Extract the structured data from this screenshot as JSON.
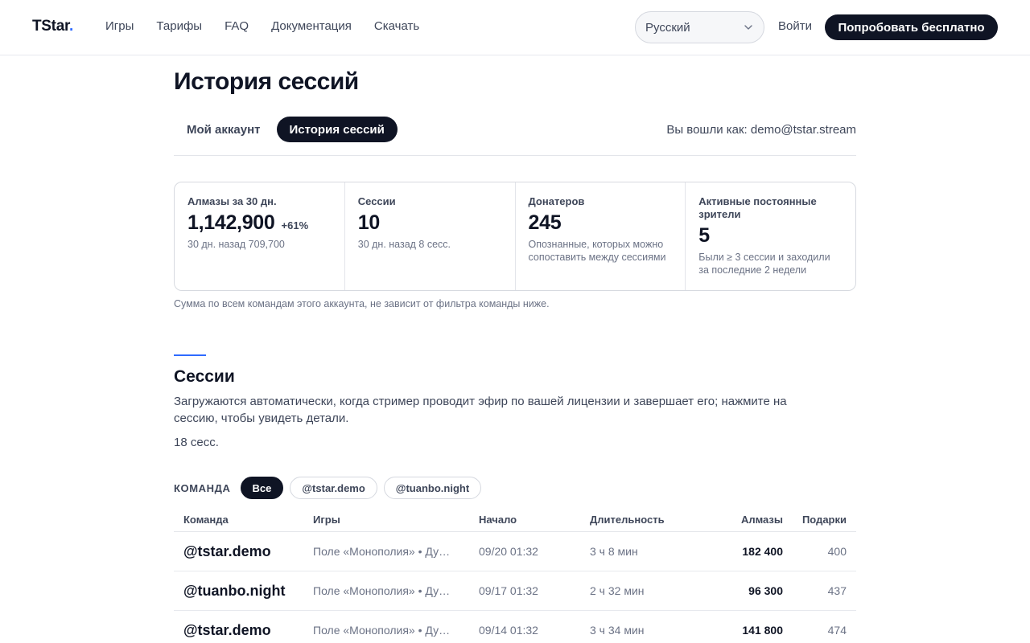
{
  "header": {
    "logo": "TStar",
    "logo_dot": ".",
    "nav": [
      "Игры",
      "Тарифы",
      "FAQ",
      "Документация",
      "Скачать"
    ],
    "language": "Русский",
    "login": "Войти",
    "cta": "Попробовать бесплатно"
  },
  "page": {
    "title": "История сессий",
    "tabs": [
      {
        "label": "Мой аккаунт",
        "active": false
      },
      {
        "label": "История сессий",
        "active": true
      }
    ],
    "logged_in_as": "Вы вошли как: demo@tstar.stream"
  },
  "stats": [
    {
      "label": "Алмазы за 30 дн.",
      "value": "1,142,900",
      "delta": "+61%",
      "sub": "30 дн. назад 709,700"
    },
    {
      "label": "Сессии",
      "value": "10",
      "delta": "",
      "sub": "30 дн. назад 8 сесс."
    },
    {
      "label": "Донатеров",
      "value": "245",
      "delta": "",
      "sub": "Опознанные, которых можно сопоставить между сессиями"
    },
    {
      "label": "Активные постоянные зрители",
      "value": "5",
      "delta": "",
      "sub": "Были ≥ 3 сессии и заходили за последние 2 недели"
    }
  ],
  "stats_note": "Сумма по всем командам этого аккаунта, не зависит от фильтра команды ниже.",
  "sessions": {
    "title": "Сессии",
    "description": "Загружаются автоматически, когда стример проводит эфир по вашей лицензии и завершает его; нажмите на сессию, чтобы увидеть детали.",
    "count": "18 сесс.",
    "filter_label": "КОМАНДА",
    "filters": [
      {
        "label": "Все",
        "active": true
      },
      {
        "label": "@tstar.demo",
        "active": false
      },
      {
        "label": "@tuanbo.night",
        "active": false
      }
    ],
    "columns": {
      "team": "Команда",
      "games": "Игры",
      "start": "Начало",
      "duration": "Длительность",
      "diamonds": "Алмазы",
      "gifts": "Подарки"
    },
    "rows": [
      {
        "team": "@tstar.demo",
        "games": "Поле «Монополия» • Ду…",
        "start": "09/20 01:32",
        "duration": "3 ч 8 мин",
        "diamonds": "182 400",
        "gifts": "400"
      },
      {
        "team": "@tuanbo.night",
        "games": "Поле «Монополия» • Ду…",
        "start": "09/17 01:32",
        "duration": "2 ч 32 мин",
        "diamonds": "96 300",
        "gifts": "437"
      },
      {
        "team": "@tstar.demo",
        "games": "Поле «Монополия» • Ду…",
        "start": "09/14 01:32",
        "duration": "3 ч 34 мин",
        "diamonds": "141 800",
        "gifts": "474"
      }
    ]
  }
}
